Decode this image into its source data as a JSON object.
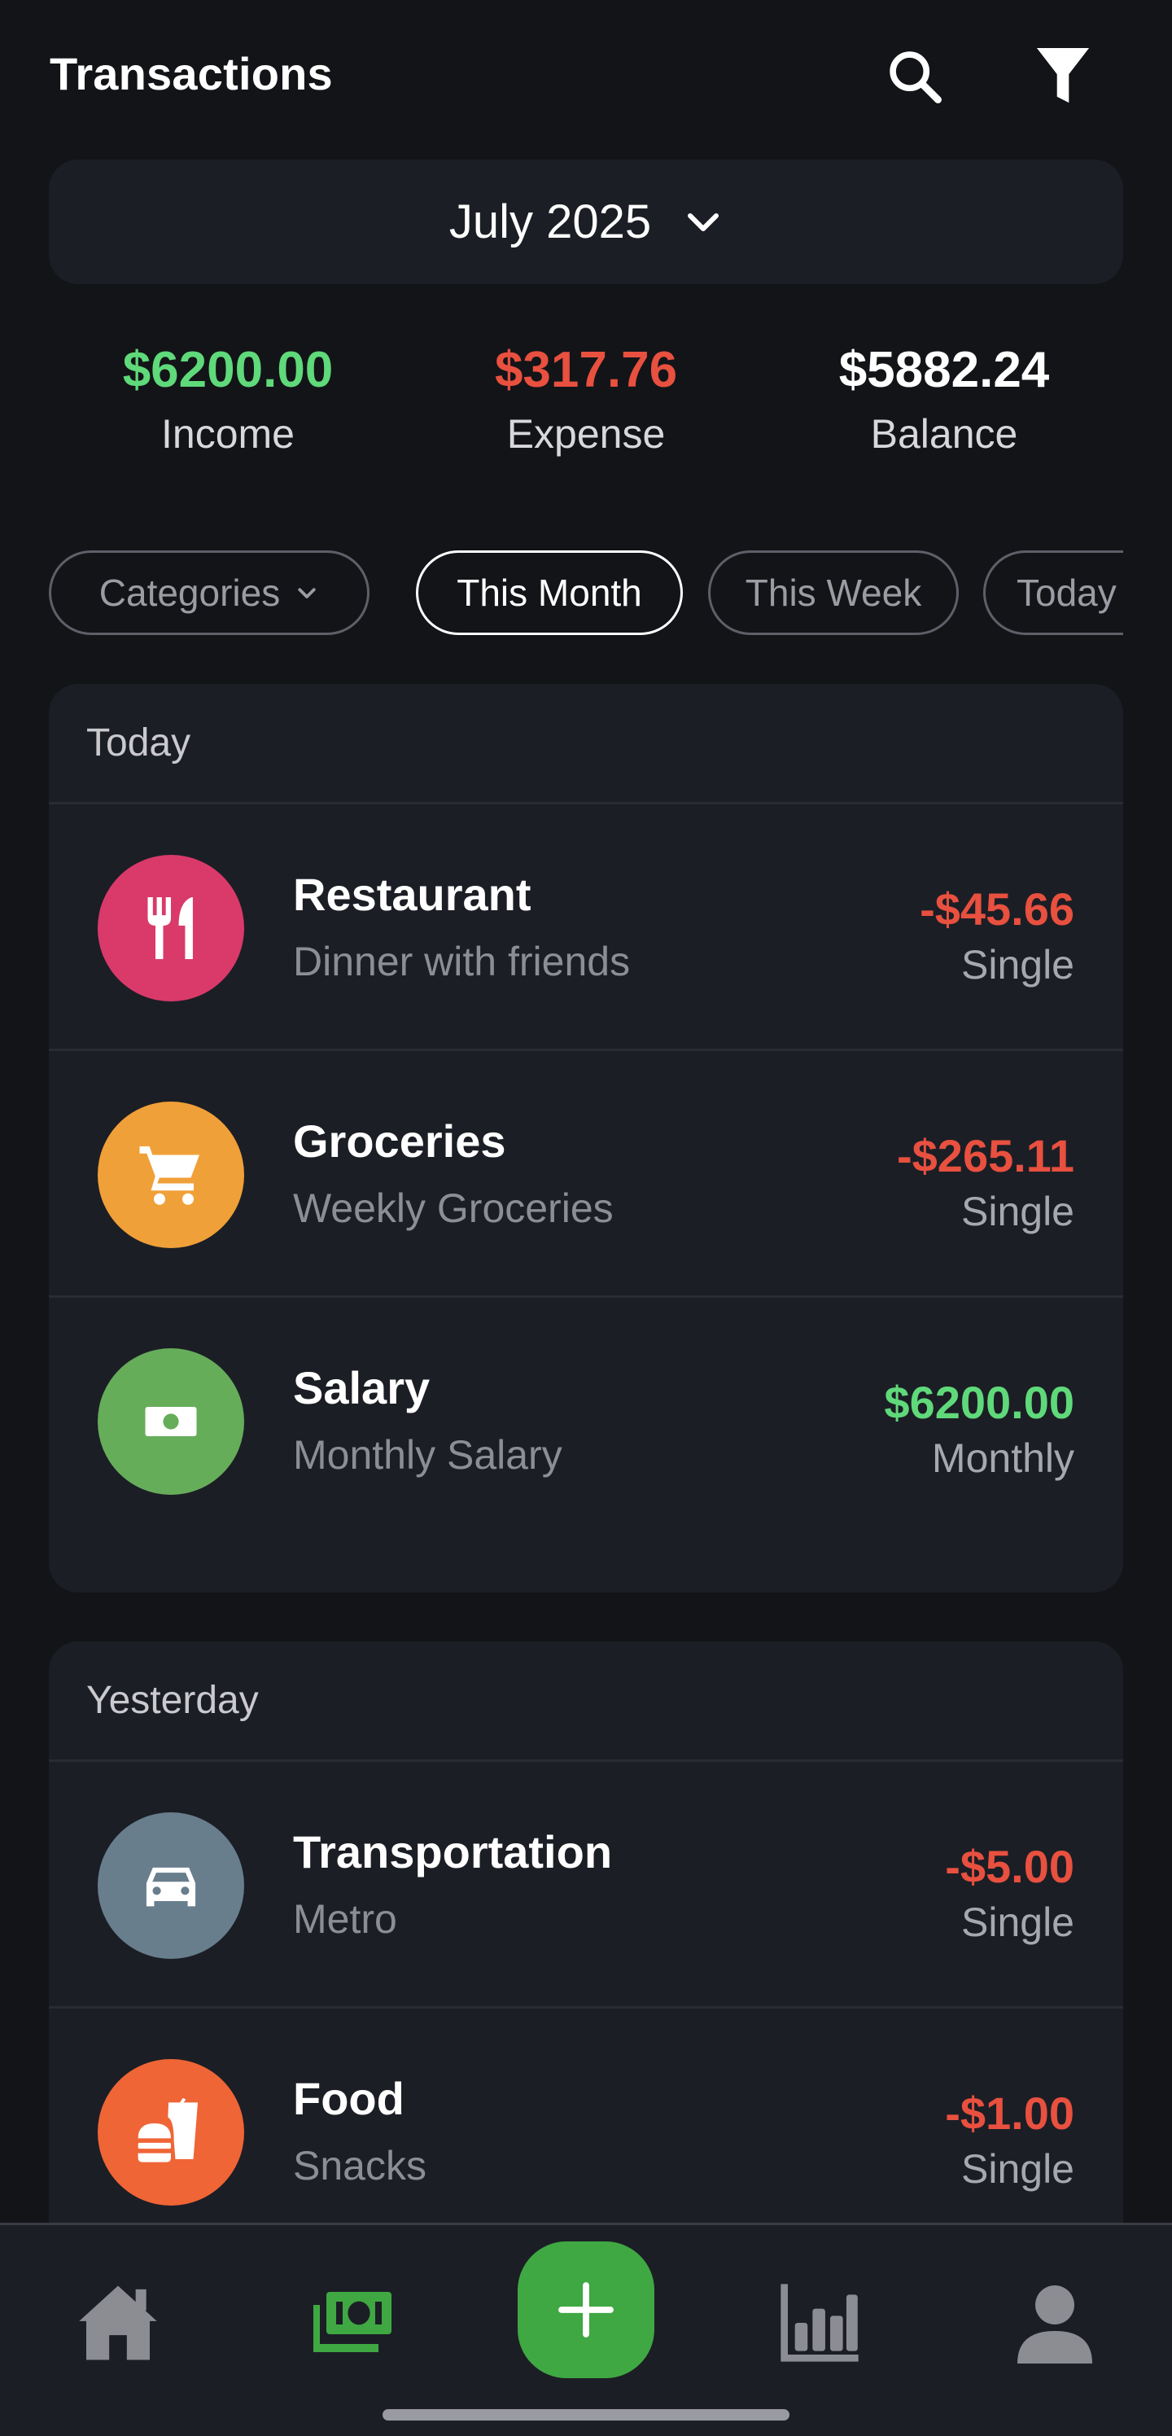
{
  "header": {
    "title": "Transactions",
    "search_icon": "search-icon",
    "filter_icon": "filter-icon"
  },
  "month_selector": {
    "label": "July 2025",
    "icon": "chevron-down-icon"
  },
  "summary": {
    "income": {
      "amount": "$6200.00",
      "label": "Income",
      "color": "#5fd97a"
    },
    "expense": {
      "amount": "$317.76",
      "label": "Expense",
      "color": "#e8503f"
    },
    "balance": {
      "amount": "$5882.24",
      "label": "Balance",
      "color": "#ffffff"
    }
  },
  "filters": {
    "categories": "Categories",
    "this_month": "This Month",
    "this_week": "This Week",
    "today": "Today",
    "selected": "This Month"
  },
  "groups": [
    {
      "day": "Today",
      "transactions": [
        {
          "name": "Restaurant",
          "desc": "Dinner with friends",
          "amount": "-$45.66",
          "freq": "Single",
          "icon": "fork-knife-icon",
          "color": "#d93a6a"
        },
        {
          "name": "Groceries",
          "desc": "Weekly Groceries",
          "amount": "-$265.11",
          "freq": "Single",
          "icon": "cart-icon",
          "color": "#f0a038"
        },
        {
          "name": "Salary",
          "desc": "Monthly Salary",
          "amount": "$6200.00",
          "freq": "Monthly",
          "icon": "money-icon",
          "color": "#66ad5a"
        }
      ]
    },
    {
      "day": "Yesterday",
      "transactions": [
        {
          "name": "Transportation",
          "desc": "Metro",
          "amount": "-$5.00",
          "freq": "Single",
          "icon": "car-icon",
          "color": "#687e8d"
        },
        {
          "name": "Food",
          "desc": "Snacks",
          "amount": "-$1.00",
          "freq": "Single",
          "icon": "fastfood-icon",
          "color": "#ef6536"
        }
      ]
    }
  ],
  "bottom_nav": {
    "items": [
      "home-icon",
      "money-stack-icon",
      "plus-icon",
      "bar-chart-icon",
      "profile-icon"
    ],
    "active": "money-stack-icon",
    "active_color": "#3fa843"
  }
}
